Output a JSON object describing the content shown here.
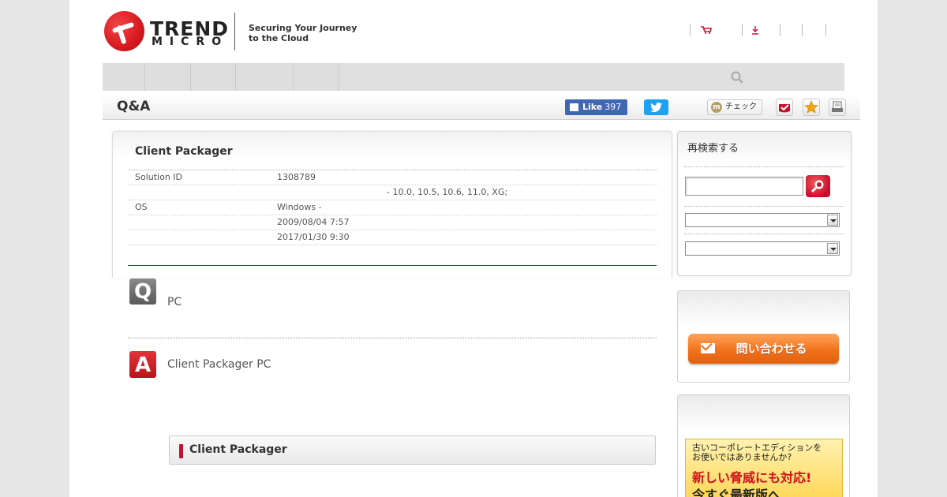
{
  "header": {
    "logo_top": "TREND",
    "logo_bottom": "MICRO",
    "logo_tm": "™",
    "tagline_line1": "Securing Your Journey",
    "tagline_line2": "to the Cloud"
  },
  "titlebar": {
    "title": "Q&A",
    "fb_like_label": "Like",
    "fb_like_count": "397",
    "mixi_check_label": "チェック"
  },
  "article": {
    "title": "Client Packager",
    "rows": [
      {
        "key": "Solution ID",
        "value": "1308789",
        "value2": ""
      },
      {
        "key": "",
        "value": "",
        "value2": "- 10.0, 10.5, 10.6, 11.0, XG;"
      },
      {
        "key": "OS",
        "value": "Windows -",
        "value2": ""
      },
      {
        "key": "",
        "value": "2009/08/04 7:57",
        "value2": ""
      },
      {
        "key": "",
        "value": "2017/01/30 9:30",
        "value2": ""
      }
    ],
    "q_icon": "Q",
    "question": "PC",
    "a_icon": "A",
    "answer": "Client Packager PC",
    "subheading": "Client Packager"
  },
  "sidebar": {
    "research_title": "再検索する",
    "search_value": "",
    "select1_value": "",
    "select2_value": "",
    "contact_label": "問い合わせる",
    "banner_line1": "古いコーポレートエディションを",
    "banner_line2": "お使いではありませんか?",
    "banner_line3": "新しい脅威にも対応!",
    "banner_line4": "今すぐ最新版へ"
  },
  "colors": {
    "brand_red": "#d71920",
    "facebook": "#4267b2",
    "twitter": "#1da1f2",
    "contact_orange": "#f2721c"
  }
}
